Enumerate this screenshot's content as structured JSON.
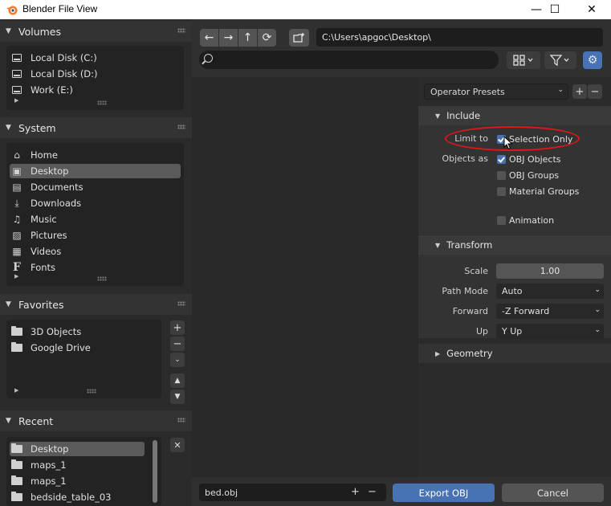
{
  "window": {
    "title": "Blender File View",
    "min_glyph": "—",
    "max_glyph": "☐",
    "close_glyph": "✕"
  },
  "sidebar": {
    "volumes": {
      "title": "Volumes",
      "items": [
        "Local Disk (C:)",
        "Local Disk (D:)",
        "Work (E:)"
      ]
    },
    "system": {
      "title": "System",
      "items": [
        "Home",
        "Desktop",
        "Documents",
        "Downloads",
        "Music",
        "Pictures",
        "Videos",
        "Fonts"
      ],
      "selected": "Desktop"
    },
    "favorites": {
      "title": "Favorites",
      "items": [
        "3D Objects",
        "Google Drive"
      ]
    },
    "recent": {
      "title": "Recent",
      "items": [
        "Desktop",
        "maps_1",
        "maps_1",
        "bedside_table_03"
      ],
      "selected": "Desktop"
    }
  },
  "toolbar": {
    "path": "C:\\Users\\apgoc\\Desktop\\",
    "search_value": ""
  },
  "options": {
    "preset_label": "Operator Presets",
    "include": {
      "title": "Include",
      "limit_to_label": "Limit to",
      "selection_only_label": "Selection Only",
      "selection_only": true,
      "objects_as_label": "Objects as",
      "obj_objects_label": "OBJ Objects",
      "obj_objects": true,
      "obj_groups_label": "OBJ Groups",
      "obj_groups": false,
      "material_groups_label": "Material Groups",
      "material_groups": false,
      "animation_label": "Animation",
      "animation": false
    },
    "transform": {
      "title": "Transform",
      "scale_label": "Scale",
      "scale_value": "1.00",
      "path_mode_label": "Path Mode",
      "path_mode_value": "Auto",
      "forward_label": "Forward",
      "forward_value": "-Z Forward",
      "up_label": "Up",
      "up_value": "Y Up"
    },
    "geometry": {
      "title": "Geometry"
    }
  },
  "footer": {
    "filename": "bed.obj",
    "export_label": "Export OBJ",
    "cancel_label": "Cancel"
  },
  "colors": {
    "accent": "#4772b3",
    "annotation": "#e0161b"
  }
}
